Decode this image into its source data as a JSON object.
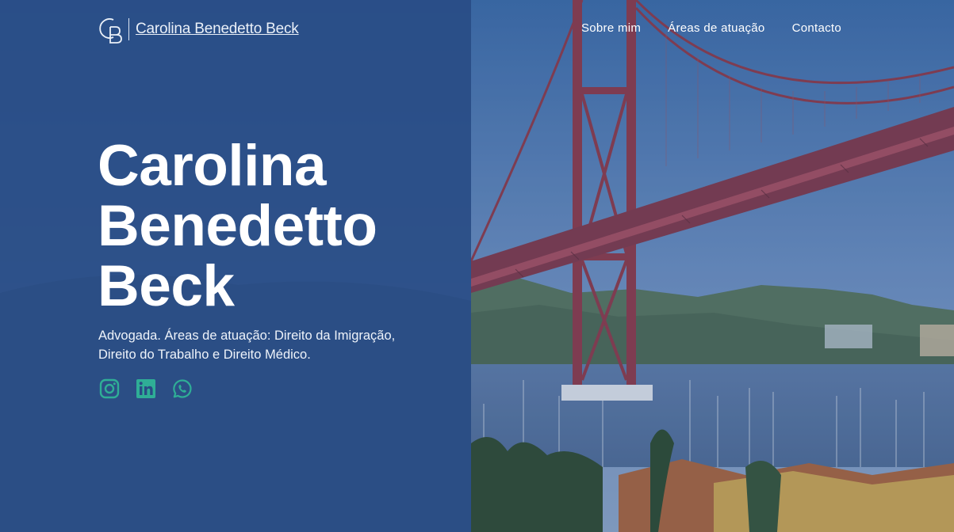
{
  "brand": {
    "name": "Carolina Benedetto Beck",
    "monogram_icon": "cb-monogram-icon"
  },
  "nav": {
    "items": [
      {
        "label": "Sobre mim"
      },
      {
        "label": "Áreas de atuação"
      },
      {
        "label": "Contacto"
      }
    ]
  },
  "hero": {
    "title_lines": [
      "Carolina",
      "Benedetto",
      "Beck"
    ],
    "subtitle_line1": "Advogada. Áreas de atuação: Direito da Imigração,",
    "subtitle_line2": "Direito do Trabalho e Direito Médico.",
    "background_image": "lisbon-bridge-photo"
  },
  "social": {
    "icons": [
      "instagram-icon",
      "linkedin-icon",
      "whatsapp-icon"
    ],
    "color": "#2fae96"
  },
  "colors": {
    "panel": "#294c85",
    "text": "#ffffff",
    "accent": "#2fae96"
  }
}
